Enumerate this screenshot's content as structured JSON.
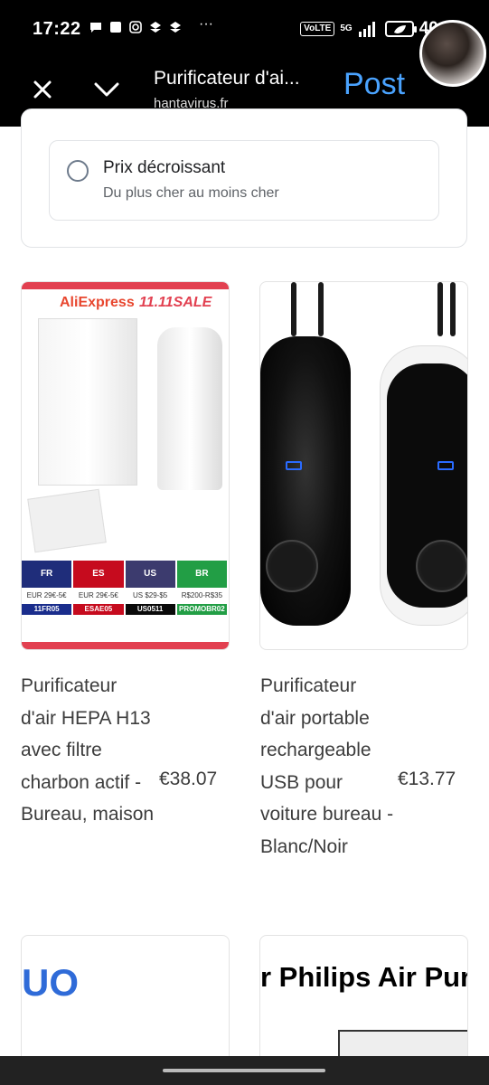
{
  "status_bar": {
    "time": "17:22",
    "more": "···",
    "volte": "VoLTE",
    "network": "5G",
    "battery": "40 %"
  },
  "top_bar": {
    "title": "Purificateur d'ai...",
    "url": "hantavirus.fr",
    "post_label": "Post"
  },
  "sort": {
    "option_label": "Prix décroissant",
    "option_sub": "Du plus cher au moins cher"
  },
  "products": [
    {
      "title": "Purificateur d'air HEPA H13 avec filtre charbon actif - Bureau, maison",
      "price": "€38.07",
      "image": {
        "brand": "AliExpress",
        "sale": "11.11SALE",
        "flags": [
          {
            "code": "FR",
            "range": "EUR 29€-5€",
            "coupon": "11FR05"
          },
          {
            "code": "ES",
            "range": "EUR 29€-5€",
            "coupon": "ESAE05"
          },
          {
            "code": "US",
            "range": "US $29-$5",
            "coupon": "US0511"
          },
          {
            "code": "BR",
            "range": "R$200-R$35",
            "coupon": "PROMOBR02"
          }
        ]
      }
    },
    {
      "title": "Purificateur d'air portable rechargeable USB pour voiture bureau - Blanc/Noir",
      "price": "€13.77"
    },
    {
      "image_text": "UO"
    },
    {
      "image_text": "r Philips Air Puri"
    }
  ],
  "colors": {
    "accent": "#4aa3ff",
    "sale_red": "#e24050",
    "text_primary": "#3c3c3c"
  }
}
